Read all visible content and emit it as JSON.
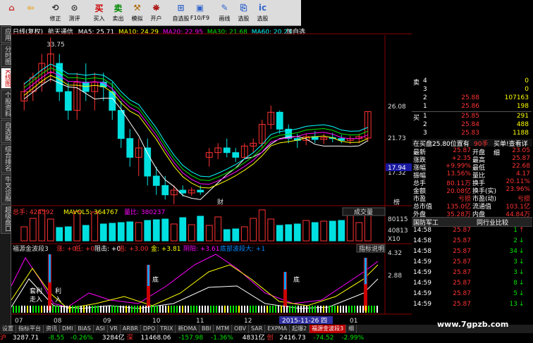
{
  "toolbar": {
    "buttons": [
      {
        "icon": "home-icon",
        "label": ""
      },
      {
        "icon": "back-icon",
        "label": ""
      },
      {
        "icon": "restore-icon",
        "label": "修正"
      },
      {
        "icon": "backtest-icon",
        "label": "测评"
      },
      {
        "icon": "buy-icon",
        "label": "买入"
      },
      {
        "icon": "sell-icon",
        "label": "卖出"
      },
      {
        "icon": "simulate-icon",
        "label": "模拟"
      },
      {
        "icon": "open-account-icon",
        "label": "开户"
      },
      {
        "icon": "self-select-icon",
        "label": "自选股"
      },
      {
        "icon": "f10-icon",
        "label": "F10/F9"
      },
      {
        "icon": "draw-icon",
        "label": "画线"
      },
      {
        "icon": "pick-icon",
        "label": "选股"
      },
      {
        "icon": "stock-pick-icon",
        "label": "选股"
      }
    ],
    "glyphs": [
      "⌂",
      "⇦",
      "⟲",
      "⊙",
      "买",
      "卖",
      "⚒",
      "⛯",
      "⊞",
      "▣",
      "✎",
      "⎘",
      "ic"
    ]
  },
  "left_tabs": [
    "应用",
    "分时图",
    "K线图",
    "个股资料",
    "自选股",
    "综合排名",
    "牛叉诊股",
    "超级盘口"
  ],
  "chart": {
    "header": {
      "period": "日线(复权)",
      "name": "航天通信",
      "ma5": "MA5: 25.71",
      "ma10": "MA10: 24.29",
      "ma20": "MA20: 22.95",
      "ma30": "MA30: 21.68",
      "ma60": "MA60: 20.23",
      "extra": "加自选"
    },
    "price_labels": {
      "high": "33.75",
      "p1": "26.08",
      "p2": "21.73",
      "p3": "17.32",
      "cur": "17.94"
    },
    "volume_header": {
      "total": "总手: 424592",
      "mavol": "MAVOL5: 364767",
      "ratio": "量比: 380237",
      "label": "成交量"
    },
    "volume_axis": {
      "top": "80115",
      "mid": "40813",
      "unit": "X10"
    },
    "indicator_header": {
      "name": "福源金波段3",
      "items": [
        "涨: +0",
        "低: +0",
        "阻击: +0",
        "逃: +3.00",
        "金: +3.81",
        "阴阳: +3.61",
        "底部波段大: +1"
      ],
      "help": "指标说明"
    },
    "indicator_axis": {
      "top": "4.32",
      "mid": "2.88"
    },
    "labels": {
      "cai": "财",
      "bang": "榜",
      "di1": "底",
      "di2": "底",
      "tao1": "套利",
      "tao2": "走入",
      "li1": "利",
      "li2": "入",
      "date": "2015-11-26 四"
    },
    "x_axis": [
      "07",
      "08",
      "09",
      "10",
      "11",
      "12",
      "01"
    ]
  },
  "quote": {
    "sell": [
      {
        "lvl": "4",
        "price": "",
        "vol": "0"
      },
      {
        "lvl": "3",
        "price": "",
        "vol": "0"
      },
      {
        "lvl": "2",
        "price": "25.88",
        "vol": "107163"
      },
      {
        "lvl": "1",
        "price": "25.86",
        "vol": "198"
      }
    ],
    "buy": [
      {
        "lvl": "1",
        "price": "25.85",
        "vol": "291"
      },
      {
        "lvl": "2",
        "price": "25.84",
        "vol": "488"
      },
      {
        "lvl": "3",
        "price": "25.83",
        "vol": "1188"
      }
    ],
    "side_sell": "卖",
    "side_buy": "买",
    "bar": {
      "left": "在买盘25.80位置有",
      "mid": "90手",
      "right": "买单!查看详细"
    },
    "rows": [
      {
        "l": "最新",
        "lv": "25.87",
        "r": "开盘",
        "rv": "23.05"
      },
      {
        "l": "涨跌",
        "lv": "+2.35",
        "r": "最高",
        "rv": "25.87"
      },
      {
        "l": "涨幅",
        "lv": "+9.99%",
        "r": "最低",
        "rv": "22.68"
      },
      {
        "l": "振幅",
        "lv": "13.56%",
        "r": "量比",
        "rv": "4.17"
      },
      {
        "l": "总手",
        "lv": "80.11万",
        "r": "换手",
        "rv": "20.11%"
      },
      {
        "l": "金额",
        "lv": "20.08亿",
        "r": "换手(实)",
        "rv": "23.96%"
      },
      {
        "l": "市盈",
        "lv": "亏损",
        "r": "市盈(动)",
        "rv": "亏损"
      },
      {
        "l": "总市值",
        "lv": "135.0亿",
        "r": "流通值",
        "rv": "103.1亿"
      },
      {
        "l": "外盘",
        "lv": "35.28万",
        "r": "内盘",
        "rv": "44.84万"
      }
    ],
    "section": {
      "left": "国防军工",
      "right": "同行业比较"
    },
    "ticks": [
      {
        "t": "14:58",
        "p": "25.87",
        "v": "1",
        "d": "up"
      },
      {
        "t": "14:58",
        "p": "25.87",
        "v": "2",
        "d": "dn"
      },
      {
        "t": "14:58",
        "p": "25.87",
        "v": "34",
        "d": "dn"
      },
      {
        "t": "14:59",
        "p": "25.87",
        "v": "3",
        "d": "dn"
      },
      {
        "t": "14:59",
        "p": "25.87",
        "v": "3",
        "d": "dn"
      },
      {
        "t": "14:59",
        "p": "25.87",
        "v": "8",
        "d": "dn"
      },
      {
        "t": "14:59",
        "p": "25.87",
        "v": "5",
        "d": "dn"
      },
      {
        "t": "14:59",
        "p": "25.87",
        "v": "13",
        "d": "dn"
      }
    ]
  },
  "bottom_tabs": [
    "设置",
    "指标平台",
    "资讯",
    "DMI",
    "BIAS",
    "ASI",
    "VR",
    "ARBR",
    "DPO",
    "TRIX",
    "新DMA",
    "BBI",
    "MTM",
    "OBV",
    "SAR",
    "EXPMA",
    "起爆2",
    "福源金波段3",
    "细"
  ],
  "status": {
    "sh_label": "沪",
    "sh_val": "3287.71",
    "sh_chg": "-8.55",
    "sh_pct": "-0.26%",
    "sh_amt": "3284亿",
    "sz_label": "深",
    "sz_val": "11468.06",
    "sz_chg": "-157.98",
    "sz_pct": "-1.36%",
    "sz_amt": "4831亿",
    "cy_label": "创",
    "cy_val": "2416.73",
    "cy_chg": "-74.52",
    "cy_pct": "-2.99%"
  },
  "watermark": "www.7gpzb.com",
  "chart_data": {
    "type": "candlestick",
    "candles": [
      [
        27,
        29,
        26,
        28
      ],
      [
        28,
        30,
        27,
        29.5
      ],
      [
        29,
        32,
        28,
        31
      ],
      [
        30,
        33.75,
        29,
        32
      ],
      [
        31,
        32,
        27,
        28
      ],
      [
        28,
        29,
        25,
        26
      ],
      [
        26,
        30,
        25,
        29
      ],
      [
        29,
        31,
        27,
        28
      ],
      [
        28,
        30,
        26,
        29
      ],
      [
        29,
        30,
        27,
        28.5
      ],
      [
        28,
        29,
        25,
        26
      ],
      [
        26,
        27,
        22,
        23
      ],
      [
        23,
        24,
        20,
        21
      ],
      [
        21,
        23,
        19,
        22
      ],
      [
        22,
        23,
        18,
        19
      ],
      [
        19,
        20,
        17,
        18
      ],
      [
        18,
        19,
        16.5,
        17
      ],
      [
        17,
        18,
        16,
        17.5
      ],
      [
        17.5,
        18,
        16.8,
        17.2
      ],
      [
        17.2,
        17.8,
        16.9,
        17.5
      ],
      [
        17.5,
        18,
        17,
        17.3
      ],
      [
        21,
        22,
        20,
        21.5
      ],
      [
        21.5,
        22.5,
        20.8,
        22
      ],
      [
        22,
        23,
        21,
        21.5
      ],
      [
        21.5,
        22,
        20.5,
        21
      ],
      [
        21,
        22.5,
        20.8,
        22.2
      ],
      [
        22.2,
        23,
        21.5,
        22.5
      ],
      [
        22.5,
        25,
        22,
        24.5
      ],
      [
        24.5,
        26.5,
        24,
        25.8
      ],
      [
        25.8,
        26,
        23.5,
        24
      ],
      [
        24,
        24.5,
        22.5,
        23
      ],
      [
        23,
        23.5,
        22,
        22.8
      ],
      [
        22.8,
        23.5,
        22.3,
        23.2
      ],
      [
        23.2,
        23.8,
        22.5,
        22.9
      ],
      [
        22.9,
        23.5,
        22.4,
        23.1
      ],
      [
        23.1,
        23.6,
        22.6,
        23
      ],
      [
        23,
        23.4,
        22.5,
        22.8
      ],
      [
        22.8,
        23.3,
        22.4,
        23
      ],
      [
        23,
        23.5,
        22.5,
        23.2
      ],
      [
        23.05,
        25.87,
        22.68,
        25.87
      ]
    ],
    "ylim": [
      16,
      34
    ]
  }
}
